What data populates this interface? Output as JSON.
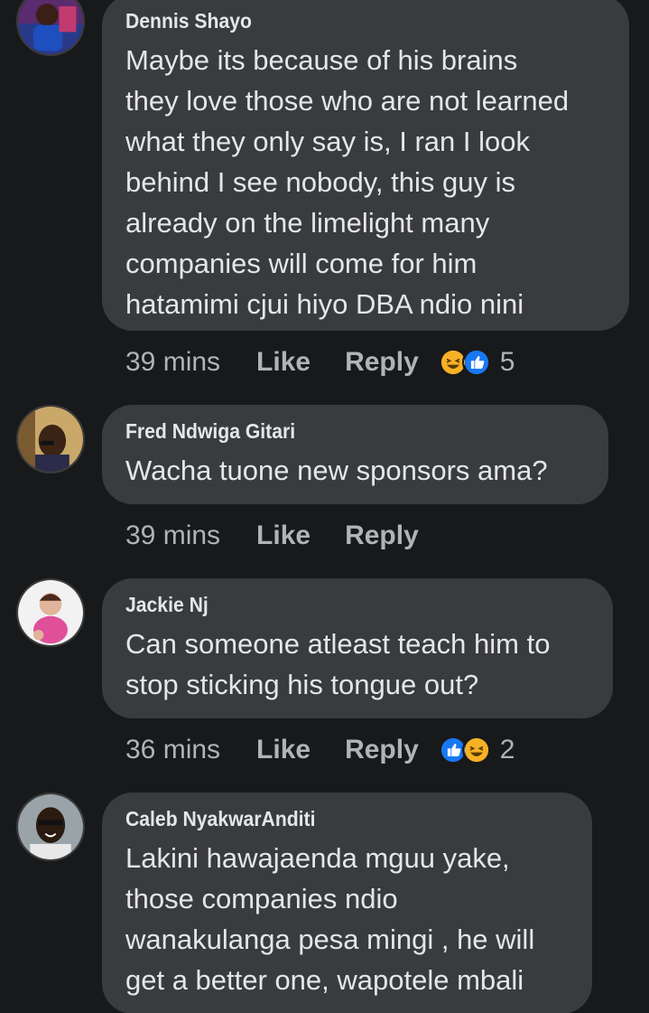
{
  "comments": [
    {
      "author": "Dennis Shayo",
      "text": "Maybe its because of his brains\nthey love those who are not learned\nwhat they only say is, I ran I look\nbehind I see nobody,  this guy is\nalready on the limelight  many\ncompanies will come for  him\nhatamimi cjui hiyo DBA ndio nini",
      "time": "39 mins",
      "like_label": "Like",
      "reply_label": "Reply",
      "reactions": [
        "haha-icon",
        "like-icon"
      ],
      "reaction_count": "5"
    },
    {
      "author": "Fred Ndwiga Gitari",
      "text": "Wacha tuone new sponsors ama?",
      "time": "39 mins",
      "like_label": "Like",
      "reply_label": "Reply",
      "reactions": [],
      "reaction_count": ""
    },
    {
      "author": "Jackie Nj",
      "text": "Can someone atleast teach him to\nstop sticking his tongue out?",
      "time": "36 mins",
      "like_label": "Like",
      "reply_label": "Reply",
      "reactions": [
        "like-icon",
        "haha-icon"
      ],
      "reaction_count": "2"
    },
    {
      "author": "Caleb NyakwarAnditi",
      "text": "Lakini hawajaenda mguu yake,\nthose companies ndio\nwanakulanga pesa mingi , he will\nget a better one, wapotele mbali",
      "time": "",
      "like_label": "",
      "reply_label": "",
      "reactions": [],
      "reaction_count": ""
    }
  ],
  "colors": {
    "background": "#18191a",
    "bubble": "#3a3b3c",
    "text_primary": "#e4e6eb",
    "text_secondary": "#b0b3b8",
    "like_blue": "#1877f2",
    "haha_yellow": "#f7b125"
  }
}
